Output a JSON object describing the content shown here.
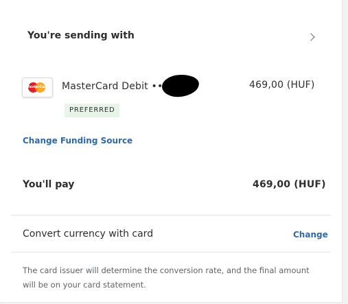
{
  "sending": {
    "title": "You're sending with",
    "chevron_icon": "chevron-right-icon"
  },
  "funding_source": {
    "card_icon": "mastercard-logo",
    "logo_text": "MasterCard",
    "name": "MasterCard Debit •••",
    "amount": "469,00 (HUF)",
    "badge": "PREFERRED",
    "change_link": "Change Funding Source"
  },
  "total": {
    "label": "You'll pay",
    "amount": "469,00 (HUF)"
  },
  "conversion": {
    "label": "Convert currency with card",
    "change_link": "Change",
    "note": "The card issuer will determine the conversion rate, and the final amount will be on your card statement."
  },
  "colors": {
    "link": "#2f6aa8",
    "badge_bg": "#e7f4e7",
    "text": "#2c2e2f",
    "muted": "#5f6368"
  }
}
